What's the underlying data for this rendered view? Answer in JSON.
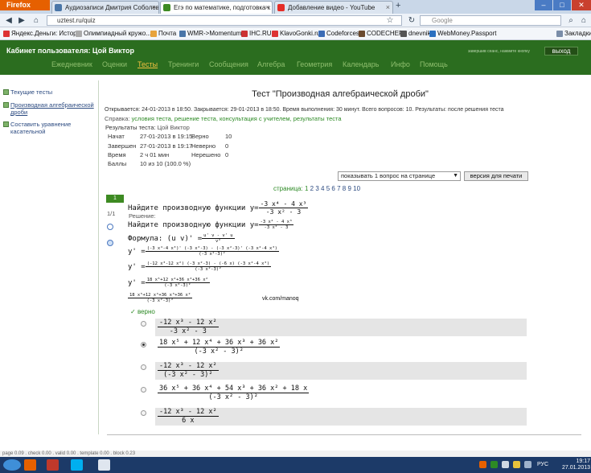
{
  "browser": {
    "menu_button": "Firefox",
    "tabs": [
      {
        "label": "Аудиозаписи Дмитрия Соболева | 4...",
        "icon": "vk-icon",
        "color": "#4a76a8"
      },
      {
        "label": "Егэ по математике, подготовка к те...",
        "icon": "uztest-icon",
        "color": "#3d8a22"
      },
      {
        "label": "Добавление видео - YouTube",
        "icon": "youtube-icon",
        "color": "#e52d27"
      }
    ],
    "new_tab": "+",
    "url": "uztest.ru/quiz",
    "search_placeholder": "Google",
    "bookmarks": [
      {
        "label": "Яндекс.Деньги: Истор...",
        "color": "#d33"
      },
      {
        "label": "Олимпиадный кружо...",
        "color": "#aaa"
      },
      {
        "label": "Почта",
        "color": "#e8a33b"
      },
      {
        "label": "WMR->Momentum",
        "color": "#4a76a8"
      },
      {
        "label": "IHC.RU",
        "color": "#c33"
      },
      {
        "label": "KlavoGonki.ru",
        "color": "#d33"
      },
      {
        "label": "Codeforces",
        "color": "#3b6cb5"
      },
      {
        "label": "CODECHEF",
        "color": "#6b4a2e"
      },
      {
        "label": "dnevnik",
        "color": "#555"
      },
      {
        "label": "WebMoney.Passport",
        "color": "#2a6fbf"
      }
    ],
    "bookmarks_menu": "Закладки"
  },
  "site": {
    "cabinet_title": "Кабинет пользователя: Цой Виктор",
    "exit_hint": "завершив сеанс, нажмите кнопку",
    "exit_button": "выход",
    "nav": [
      {
        "label": "Ежедневник",
        "selected": false
      },
      {
        "label": "Оценки",
        "selected": false
      },
      {
        "label": "Тесты",
        "selected": true
      },
      {
        "label": "Тренинги",
        "selected": false
      },
      {
        "label": "Сообщения",
        "selected": false
      },
      {
        "label": "Алгебра",
        "selected": false
      },
      {
        "label": "Геометрия",
        "selected": false
      },
      {
        "label": "Календарь",
        "selected": false
      },
      {
        "label": "Инфо",
        "selected": false
      },
      {
        "label": "Помощь",
        "selected": false
      }
    ]
  },
  "sidebar": {
    "items": [
      {
        "label": "Текущие тесты"
      },
      {
        "label": "Производная алгебраической дроби"
      },
      {
        "label": "Составить уравнение касательной"
      }
    ]
  },
  "test": {
    "title": "Тест \"Производная алгебраической дроби\"",
    "meta_line": "Открывается: 24-01-2013 в 18:50. Закрывается: 29-01-2013 в 18:50. Время выполнения: 30 минут. Всего вопросов: 10. Результаты: после решения теста",
    "help_label": "Справка:",
    "help_links": "условия теста, решение теста, консультация с учителем, результаты теста",
    "results_label": "Результаты теста:",
    "results_user": "Цой Виктор",
    "results": [
      {
        "label": "Начат",
        "value": "27-01-2013 в 19:15",
        "label2": "Верно",
        "value2": "10"
      },
      {
        "label": "Завершен",
        "value": "27-01-2013 в 19:17",
        "label2": "Неверно",
        "value2": "0"
      },
      {
        "label": "Время",
        "value": "2 ч 01 мин",
        "label2": "Нерешено",
        "value2": "0"
      },
      {
        "label": "Баллы",
        "value": "10 из 10 (100.0 %)",
        "label2": "",
        "value2": ""
      }
    ],
    "per_page_select": "показывать 1 вопрос на странице",
    "print_button": "версия для печати",
    "pager_label": "страница:",
    "pages": [
      "1",
      "2",
      "3",
      "4",
      "5",
      "6",
      "7",
      "8",
      "9",
      "10"
    ],
    "question_number": "1",
    "question_fraction": "1/1",
    "question_text": "Найдите производную функции y=",
    "question_num_expr": "-3 x⁴ - 4 x³",
    "question_den_expr": "-3 x² - 3",
    "solution_label": "Решение:",
    "solution_restate": "Найдите производную функции y=",
    "solution_restate_num": "-3 x⁴ - 4 x³",
    "solution_restate_den": "-3 x² - 3",
    "formula_label": "Формула:",
    "formula_lhs": "(u v)' =",
    "formula_num": "u' v - v' u",
    "formula_den": "v²",
    "step1_lhs": "y' =",
    "step1_num": "(-3 x⁴-4 x³)' (-3 x²-3) - (-3 x²-3)' (-3 x⁴-4 x³)",
    "step1_den": "(-3 x²-3)²",
    "step2_lhs": "y' =",
    "step2_num": "(-12 x³-12 x²) (-3 x²-3) - (-6 x) (-3 x⁴-4 x³)",
    "step2_den": "(-3 x²-3)²",
    "step3_lhs": "y' =",
    "step3_num": "18 x⁵+12 x⁴+36 x³+36 x²",
    "step3_den": "(-3 x²-3)²",
    "step4_num": "18 x⁵+12 x⁴+36 x³+36 x²",
    "step4_den": "(-3 x²-3)²",
    "watermark": "vk.com/manoq",
    "verdict": "верно",
    "options": [
      {
        "num": "-12 x³ - 12 x²",
        "den": "-3 x² - 3",
        "checked": false
      },
      {
        "num": "18 x⁵ + 12 x⁴ + 36 x³ + 36 x²",
        "den": "(-3 x² - 3)²",
        "checked": true
      },
      {
        "num": "-12 x³ - 12 x²",
        "den": "(-3 x² - 3)²",
        "checked": false
      },
      {
        "num": "36 x⁵ + 36 x⁴ + 54 x³ + 36 x² + 18 x",
        "den": "(-3 x² - 3)²",
        "checked": false
      },
      {
        "num": "-12 x³ - 12 x²",
        "den": "6 x",
        "checked": false
      }
    ]
  },
  "statusbar": {
    "text": "page 0.09 . check 0.00 . valid 0.00 . template 0.00 . block 0.23"
  },
  "taskbar": {
    "language": "РУС",
    "time": "19:17",
    "date": "27.01.2013"
  }
}
